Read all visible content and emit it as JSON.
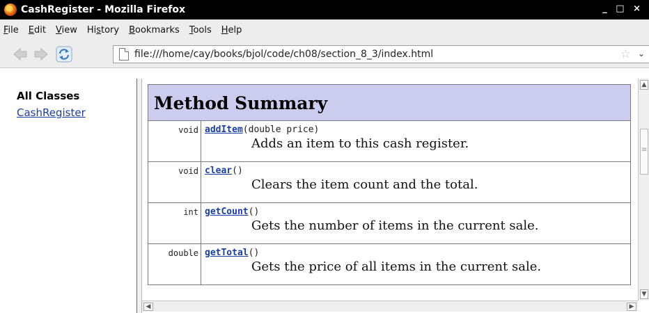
{
  "window": {
    "title": "CashRegister - Mozilla Firefox",
    "controls": "_ □ ×"
  },
  "menu": {
    "items": [
      {
        "mnemonic": "F",
        "rest": "ile"
      },
      {
        "mnemonic": "E",
        "rest": "dit"
      },
      {
        "mnemonic": "V",
        "rest": "iew"
      },
      {
        "pre": "Hi",
        "mnemonic": "s",
        "rest": "tory"
      },
      {
        "mnemonic": "B",
        "rest": "ookmarks"
      },
      {
        "mnemonic": "T",
        "rest": "ools"
      },
      {
        "mnemonic": "H",
        "rest": "elp"
      }
    ]
  },
  "nav": {
    "url": "file:///home/cay/books/bjol/code/ch08/section_8_3/index.html",
    "star_glyph": "☆",
    "dropdown_glyph": "⌄"
  },
  "sidebar": {
    "heading": "All Classes",
    "classes": [
      "CashRegister"
    ]
  },
  "summary": {
    "heading": "Method Summary",
    "methods": [
      {
        "type": "void",
        "name": "addItem",
        "params": "(double price)",
        "description": "Adds an item to this cash register."
      },
      {
        "type": "void",
        "name": "clear",
        "params": "()",
        "description": "Clears the item count and the total."
      },
      {
        "type": "int",
        "name": "getCount",
        "params": "()",
        "description": "Gets the number of items in the current sale."
      },
      {
        "type": "double",
        "name": "getTotal",
        "params": "()",
        "description": "Gets the price of all items in the current sale."
      }
    ]
  },
  "colors": {
    "table_header_bg": "#ccccee",
    "link": "#1a3ea8"
  }
}
